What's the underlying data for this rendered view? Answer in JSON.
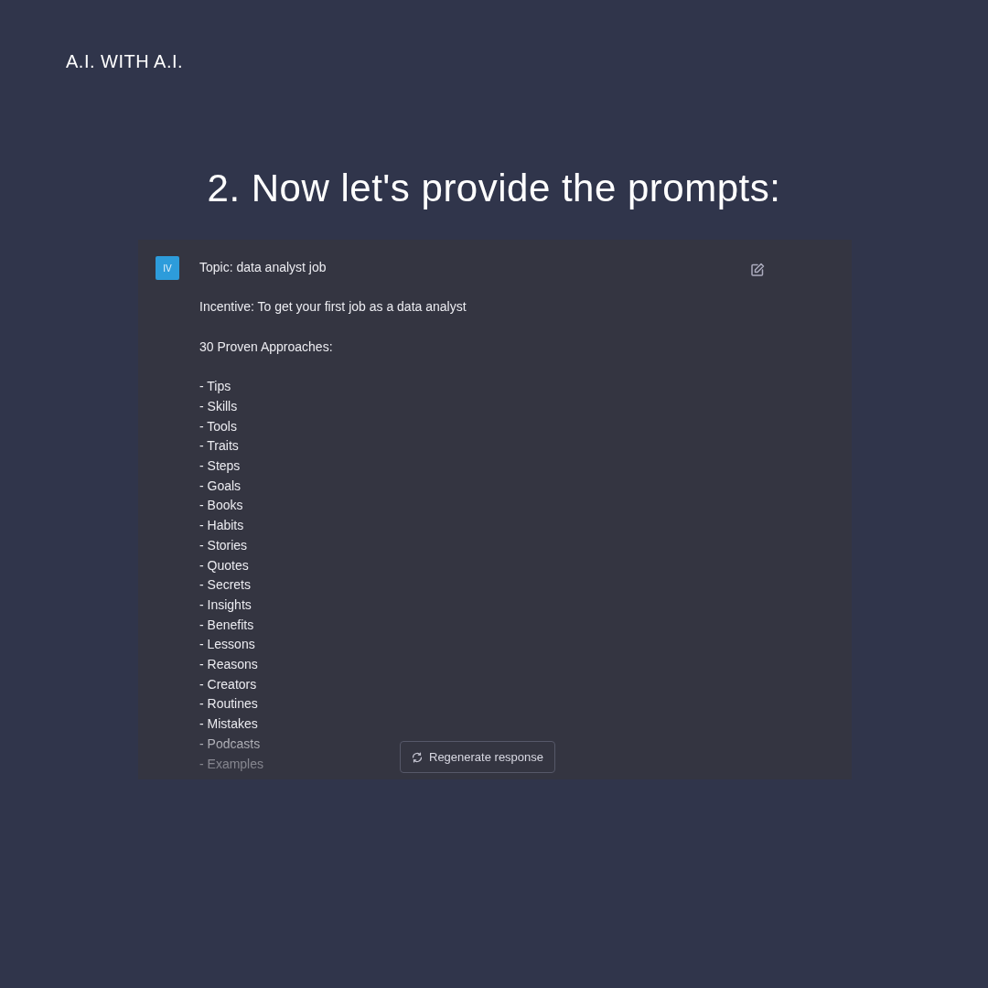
{
  "brand": "A.I. WITH A.I.",
  "heading": "2. Now let's provide the prompts:",
  "chat": {
    "avatar": "IV",
    "lines": [
      "Topic: data analyst job",
      "Incentive: To get your first job as a data analyst",
      "30 Proven Approaches:"
    ],
    "items": [
      "- Tips",
      "- Skills",
      "- Tools",
      "- Traits",
      "- Steps",
      "- Goals",
      "- Books",
      "- Habits",
      "- Stories",
      "- Quotes",
      "- Secrets",
      "- Insights",
      "- Benefits",
      "- Lessons",
      "- Reasons",
      "- Creators",
      "- Routines",
      "- Mistakes",
      "- Podcasts",
      "- Examples"
    ],
    "regenerate_button": "Regenerate response"
  }
}
